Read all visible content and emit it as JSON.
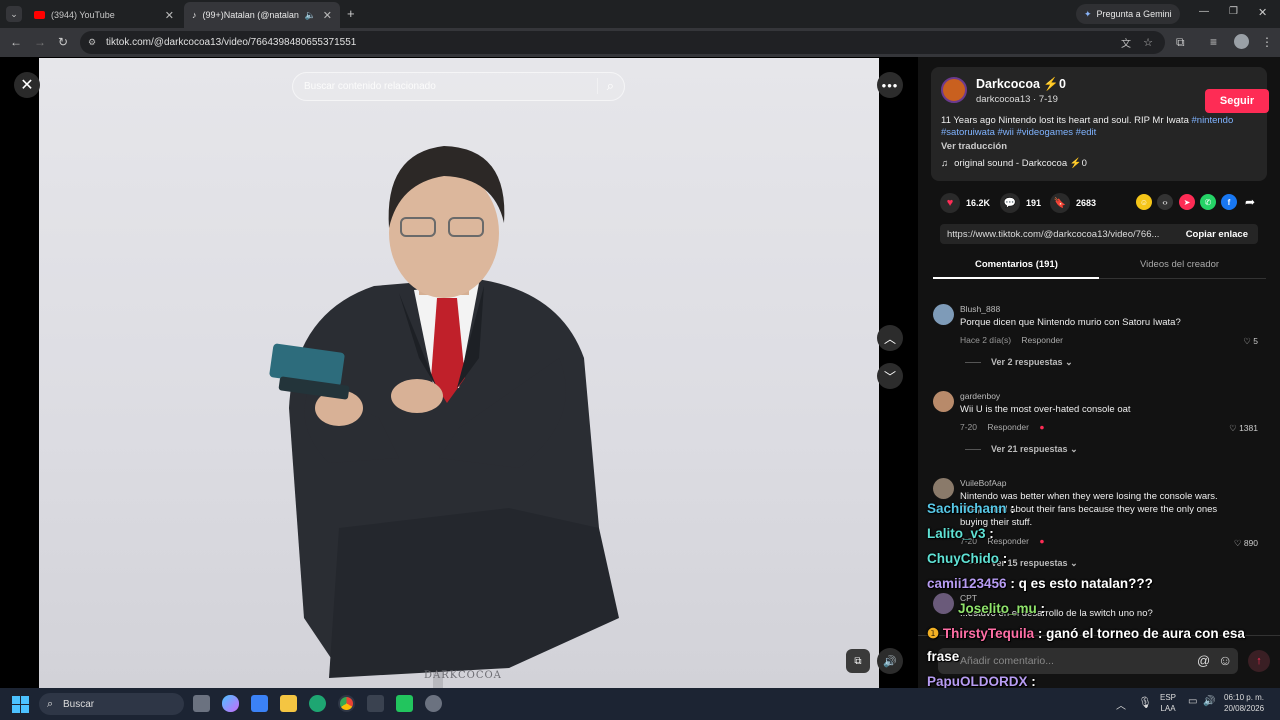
{
  "browser": {
    "tabs": [
      {
        "title": "(3944) YouTube"
      },
      {
        "title": "(99+)Natalan (@natalanx) |"
      }
    ],
    "url": "tiktok.com/@darkcocoa13/video/7664398480655371551",
    "gemini_label": "Pregunta a Gemini"
  },
  "video": {
    "search_placeholder": "Buscar contenido relacionado",
    "watermark": "DARKCOCOA"
  },
  "post": {
    "display_name": "Darkcocoa ⚡0",
    "handle_date": "darkcocoa13 · 7-19",
    "follow_label": "Seguir",
    "caption": "11 Years ago Nintendo lost its heart and soul. RIP Mr Iwata",
    "hashtags_line1": "#nintendo",
    "hashtags_line2": "#satoruiwata #wii #videogames #edit",
    "translate_label": "Ver traducción",
    "sound": "original sound - Darkcocoa ⚡0",
    "likes": "16.2K",
    "comments": "191",
    "saves": "2683",
    "link": "https://www.tiktok.com/@darkcocoa13/video/766...",
    "copy_label": "Copiar enlace"
  },
  "tabs": {
    "comments": "Comentarios (191)",
    "creator_videos": "Videos del creador"
  },
  "comments": [
    {
      "user": "Blush_888",
      "text": "Porque dicen que Nintendo murio con Satoru Iwata?",
      "date": "Hace 2 día(s)",
      "reply": "Responder",
      "likes": "5",
      "more": "Ver 2 respuestas"
    },
    {
      "user": "gardenboy",
      "text": "Wii U is the most over-hated console oat",
      "date": "7-20",
      "reply": "Responder",
      "likes": "1381",
      "more": "Ver 21 respuestas"
    },
    {
      "user": "VuileBofAap",
      "text": "Nintendo was better when they were losing the console wars. They cared about their fans because they were the only ones buying their stuff.",
      "date": "7-20",
      "reply": "Responder",
      "likes": "890",
      "more": "Ver 15 respuestas"
    },
    {
      "user": "CPT",
      "text": "...estuvo en el desarrollo de la switch uno no?",
      "date": "",
      "reply": "",
      "likes": "",
      "more": ""
    }
  ],
  "add_comment_placeholder": "Añadir comentario...",
  "stream_chat": [
    {
      "user": "Sachiichann",
      "color": "#57c7e6",
      "msg": ""
    },
    {
      "user": "Lalito_v3",
      "color": "#5fe1d4",
      "msg": ""
    },
    {
      "user": "ChuyChido",
      "color": "#5fe1d4",
      "msg": ""
    },
    {
      "user": "camii123456",
      "color": "#b79cf2",
      "msg": "q es esto natalan???"
    },
    {
      "user": "Joselito_mu",
      "color": "#8fe36b",
      "msg": ""
    },
    {
      "user": "ThirstyTequila",
      "color": "#ff6fa6",
      "msg": "ganó el torneo de aura con esa"
    },
    {
      "user": "",
      "color": "#ffffff",
      "msg": "frase"
    },
    {
      "user": "PapuOLDORDX",
      "color": "#b79cf2",
      "msg": ""
    }
  ],
  "taskbar": {
    "search_label": "Buscar",
    "lang1": "ESP",
    "lang2": "LAA",
    "time": "06:10 p. m.",
    "date": "20/08/2026"
  },
  "colors": {
    "accent": "#fe2c55",
    "hashtag": "#7fb3ff"
  }
}
